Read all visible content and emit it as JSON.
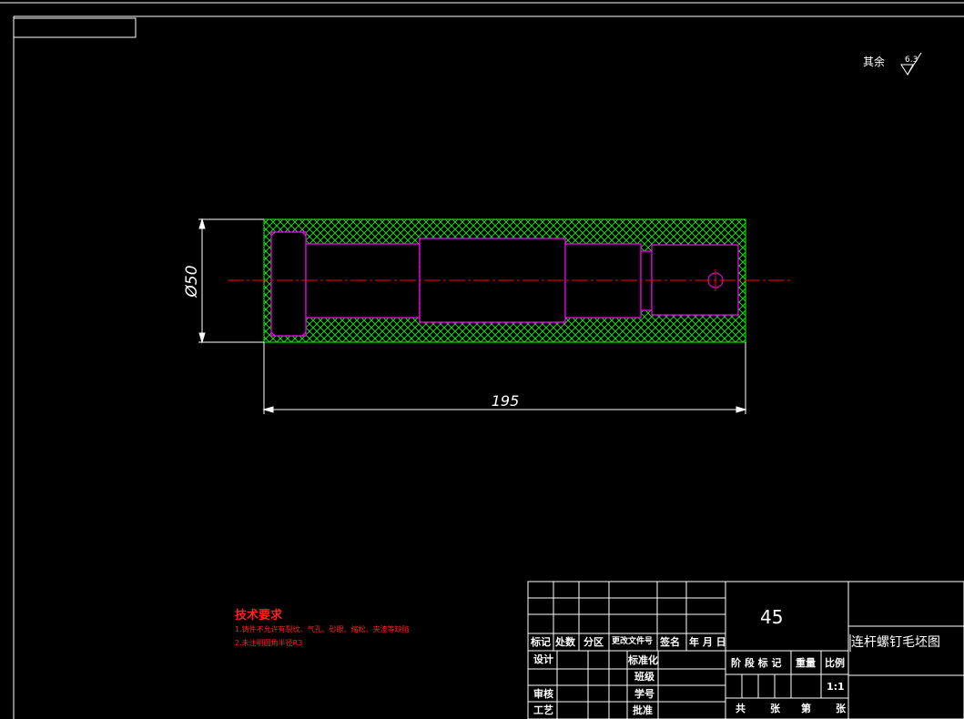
{
  "drawing": {
    "surface_roughness": {
      "label": "其余",
      "value": "6.3"
    },
    "dimensions": {
      "diameter": "Ø50",
      "length": "195"
    },
    "colors": {
      "background": "#000000",
      "frame": "#ffffff",
      "part_outline": "#ff00ff",
      "hatch": "#00ff00",
      "centerline": "#ff0000",
      "notes": "#ff2020"
    }
  },
  "notes": {
    "title": "技术要求",
    "items": [
      "1.铸件不允许有裂纹、气孔、砂眼、缩松、夹渣等缺陷",
      "2.未注明圆角半径R3"
    ]
  },
  "title_block": {
    "material": "45",
    "part_name": "连杆螺钉毛坯图",
    "revision_headers": [
      "标记",
      "处数",
      "分区",
      "更改文件号",
      "签名",
      "年 月 日"
    ],
    "roles": {
      "design": "设计",
      "standardization": "标准化",
      "class": "班级",
      "review": "审核",
      "student_id": "学号",
      "process": "工艺",
      "approve": "批准"
    },
    "stage_headers": [
      "阶 段 标 记",
      "重量",
      "比例"
    ],
    "scale": "1:1",
    "sheet_text": {
      "total": "共",
      "sheets": "张",
      "no": "第",
      "sheet": "张"
    }
  }
}
